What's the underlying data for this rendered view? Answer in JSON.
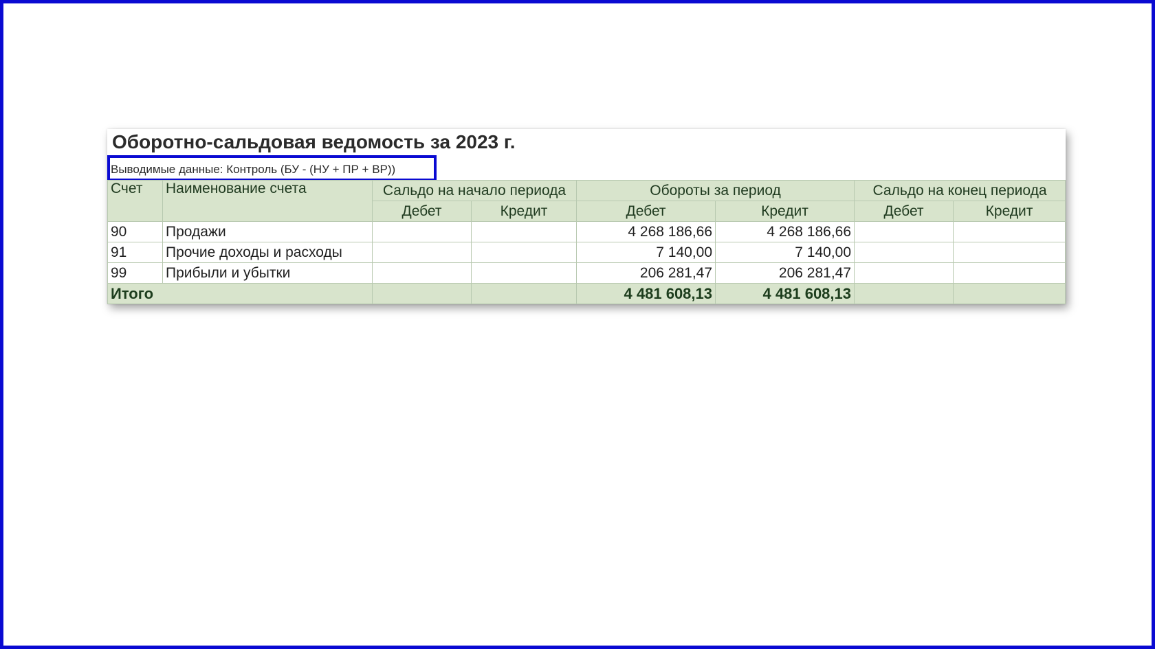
{
  "report": {
    "title": "Оборотно-сальдовая ведомость за 2023 г.",
    "subtitle": "Выводимые данные: Контроль (БУ - (НУ + ПР + ВР))"
  },
  "table": {
    "col_account": "Счет",
    "col_name": "Наименование счета",
    "group_opening": "Сальдо на начало периода",
    "group_turnover": "Обороты за период",
    "group_closing": "Сальдо на конец периода",
    "debit": "Дебет",
    "credit": "Кредит",
    "rows": [
      {
        "account": "90",
        "name": "Продажи",
        "open_debit": "",
        "open_credit": "",
        "turn_debit": "4 268 186,66",
        "turn_credit": "4 268 186,66",
        "close_debit": "",
        "close_credit": ""
      },
      {
        "account": "91",
        "name": "Прочие доходы и расходы",
        "open_debit": "",
        "open_credit": "",
        "turn_debit": "7 140,00",
        "turn_credit": "7 140,00",
        "close_debit": "",
        "close_credit": ""
      },
      {
        "account": "99",
        "name": "Прибыли и убытки",
        "open_debit": "",
        "open_credit": "",
        "turn_debit": "206 281,47",
        "turn_credit": "206 281,47",
        "close_debit": "",
        "close_credit": ""
      }
    ],
    "total": {
      "label": "Итого",
      "open_debit": "",
      "open_credit": "",
      "turn_debit": "4 481 608,13",
      "turn_credit": "4 481 608,13",
      "close_debit": "",
      "close_credit": ""
    }
  },
  "colors": {
    "frame_border": "#0a0ad2",
    "highlight_border": "#0a0ad2",
    "header_bg": "#d8e4cc"
  }
}
